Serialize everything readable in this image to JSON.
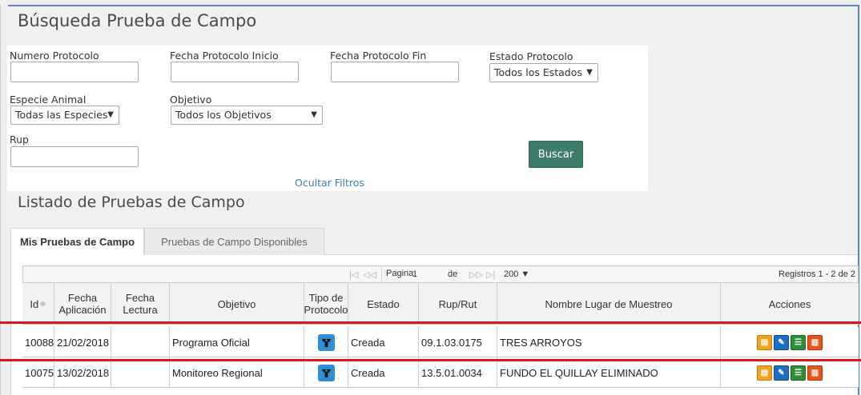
{
  "page_title": "Búsqueda Prueba de Campo",
  "filters": {
    "numero_protocolo_label": "Numero Protocolo",
    "fecha_inicio_label": "Fecha Protocolo Inicio",
    "fecha_fin_label": "Fecha Protocolo Fin",
    "estado_label": "Estado Protocolo",
    "estado_value": "Todos los Estados",
    "especie_label": "Especie Animal",
    "especie_value": "Todas las Especies",
    "objetivo_label": "Objetivo",
    "objetivo_value": "Todos los Objetivos",
    "rup_label": "Rup",
    "buscar_label": "Buscar",
    "hide_filters_label": "Ocultar Filtros"
  },
  "list_title": "Listado de Pruebas de Campo",
  "tabs": [
    {
      "label": "Mis Pruebas de Campo",
      "active": true
    },
    {
      "label": "Pruebas de Campo Disponibles",
      "active": false
    }
  ],
  "pager": {
    "first": "|◁",
    "prev": "◁◁",
    "page_label": "Pagina",
    "page_value": "1",
    "of_label": "de",
    "next": "▷▷",
    "last": "▷|",
    "page_size": "200",
    "records": "Registros 1 - 2 de 2"
  },
  "columns": [
    "Id",
    "Fecha Aplicación",
    "Fecha Lectura",
    "Objetivo",
    "Tipo de Protocolo",
    "Estado",
    "Rup/Rut",
    "Nombre Lugar de Muestreo",
    "Acciones"
  ],
  "sort_icon": "sort-icon",
  "rows": [
    {
      "id": "10088",
      "fecha_aplicacion": "21/02/2018",
      "fecha_lectura": "",
      "objetivo": "Programa Oficial",
      "tipo_icon": "protocol-type-icon",
      "estado": "Creada",
      "rup": "09.1.03.0175",
      "lugar": "TRES ARROYOS"
    },
    {
      "id": "10075",
      "fecha_aplicacion": "13/02/2018",
      "fecha_lectura": "",
      "objetivo": "Monitoreo Regional",
      "tipo_icon": "protocol-type-icon",
      "estado": "Creada",
      "rup": "13.5.01.0034",
      "lugar": "FUNDO EL QUILLAY ELIMINADO"
    }
  ],
  "action_icons": [
    "pdf-icon",
    "edit-icon",
    "view-icon",
    "delete-icon"
  ],
  "colors": {
    "accent": "#3d7b6b",
    "link": "#3c7fb1",
    "highlight": "#e01515",
    "frame": "#5b83c7",
    "protocol_icon": "#2f8fd6"
  }
}
